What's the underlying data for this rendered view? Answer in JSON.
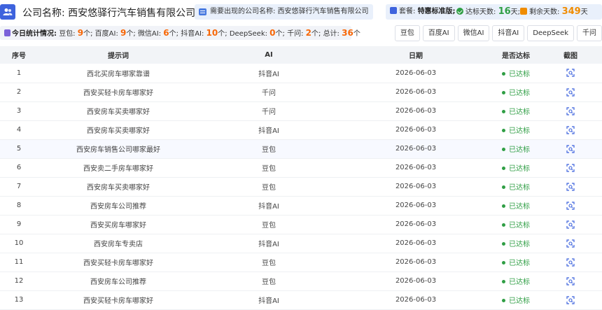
{
  "header": {
    "company_label": "公司名称: 西安悠驿行汽车销售有限公司",
    "need_label": "需要出现的公司名称: 西安悠驿行汽车销售有限公司",
    "package_label": "套餐: ",
    "package_value": "特惠标准版;",
    "reach_label": "达标天数: ",
    "reach_value": "16",
    "reach_unit": "天;",
    "remain_label": "剩余天数: ",
    "remain_value": "349",
    "remain_unit": "天"
  },
  "today": {
    "label": "今日统计情况:",
    "items": [
      {
        "name": "豆包: ",
        "count": "9",
        "unit": "个; "
      },
      {
        "name": "百度AI: ",
        "count": "9",
        "unit": "个; "
      },
      {
        "name": "微信AI: ",
        "count": "6",
        "unit": "个; "
      },
      {
        "name": "抖音AI: ",
        "count": "10",
        "unit": "个; "
      },
      {
        "name": "DeepSeek: ",
        "count": "0",
        "unit": "个; "
      },
      {
        "name": "千问: ",
        "count": "2",
        "unit": "个; "
      },
      {
        "name": "总计: ",
        "count": "36",
        "unit": "个"
      }
    ]
  },
  "filters": [
    "豆包",
    "百度AI",
    "微信AI",
    "抖音AI",
    "DeepSeek",
    "千问"
  ],
  "table": {
    "columns": [
      "序号",
      "提示词",
      "AI",
      "日期",
      "是否达标",
      "截图"
    ],
    "rows": [
      [
        "1",
        "西北买房车哪家靠谱",
        "抖音AI",
        "2026-06-03",
        "已达标"
      ],
      [
        "2",
        "西安买轻卡房车哪家好",
        "千问",
        "2026-06-03",
        "已达标"
      ],
      [
        "3",
        "西安房车买卖哪家好",
        "千问",
        "2026-06-03",
        "已达标"
      ],
      [
        "4",
        "西安房车买卖哪家好",
        "抖音AI",
        "2026-06-03",
        "已达标"
      ],
      [
        "5",
        "西安房车销售公司哪家最好",
        "豆包",
        "2026-06-03",
        "已达标"
      ],
      [
        "6",
        "西安卖二手房车哪家好",
        "豆包",
        "2026-06-03",
        "已达标"
      ],
      [
        "7",
        "西安房车买卖哪家好",
        "豆包",
        "2026-06-03",
        "已达标"
      ],
      [
        "8",
        "西安房车公司推荐",
        "抖音AI",
        "2026-06-03",
        "已达标"
      ],
      [
        "9",
        "西安买房车哪家好",
        "豆包",
        "2026-06-03",
        "已达标"
      ],
      [
        "10",
        "西安房车专卖店",
        "抖音AI",
        "2026-06-03",
        "已达标"
      ],
      [
        "11",
        "西安买轻卡房车哪家好",
        "豆包",
        "2026-06-03",
        "已达标"
      ],
      [
        "12",
        "西安房车公司推荐",
        "豆包",
        "2026-06-03",
        "已达标"
      ],
      [
        "13",
        "西安买轻卡房车哪家好",
        "抖音AI",
        "2026-06-03",
        "已达标"
      ]
    ]
  },
  "colors": {
    "accent": "#3e63dd",
    "success": "#2f9e44",
    "warning": "#f08c00",
    "count": "#f76707"
  }
}
